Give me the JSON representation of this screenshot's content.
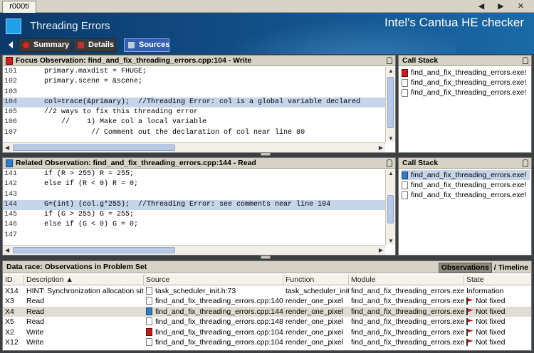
{
  "window": {
    "tab_title": "r000ti",
    "controls": "◀ ▶ ✕"
  },
  "header": {
    "title": "Threading Errors",
    "brand": "Intel's Cantua HE checker"
  },
  "nav": {
    "summary": "Summary",
    "details": "Details",
    "sources": "Sources"
  },
  "focus": {
    "title": "Focus Observation: find_and_fix_threading_errors.cpp:104 - Write",
    "lines": [
      {
        "n": "101",
        "code": "    primary.maxdist = FHUGE;",
        "hl": false
      },
      {
        "n": "102",
        "code": "    primary.scene = &scene;",
        "hl": false
      },
      {
        "n": "103",
        "code": "",
        "hl": false
      },
      {
        "n": "104",
        "code": "    col=trace(&primary);  //Threading Error: col is a global variable declared",
        "hl": true
      },
      {
        "n": "105",
        "code": "    //2 ways to fix this threading error",
        "hl": false
      },
      {
        "n": "106",
        "code": "        //    1) Make col a local variable",
        "hl": false
      },
      {
        "n": "107",
        "code": "               // Comment out the declaration of col near line 80",
        "hl": false
      }
    ]
  },
  "related": {
    "title": "Related Observation: find_and_fix_threading_errors.cpp:144 - Read",
    "lines": [
      {
        "n": "141",
        "code": "    if (R > 255) R = 255;",
        "hl": false
      },
      {
        "n": "142",
        "code": "    else if (R < 0) R = 0;",
        "hl": false
      },
      {
        "n": "143",
        "code": "",
        "hl": false
      },
      {
        "n": "144",
        "code": "    G=(int) (col.g*255);  //Threading Error: see comments near line 104",
        "hl": true
      },
      {
        "n": "145",
        "code": "    if (G > 255) G = 255;",
        "hl": false
      },
      {
        "n": "146",
        "code": "    else if (G < 0) G = 0;",
        "hl": false
      },
      {
        "n": "147",
        "code": "",
        "hl": false
      }
    ]
  },
  "callstack_top": {
    "title": "Call Stack",
    "items": [
      "find_and_fix_threading_errors.exe!",
      "find_and_fix_threading_errors.exe!",
      "find_and_fix_threading_errors.exe!"
    ]
  },
  "callstack_bottom": {
    "title": "Call Stack",
    "items": [
      "find_and_fix_threading_errors.exe!",
      "find_and_fix_threading_errors.exe!",
      "find_and_fix_threading_errors.exe!"
    ]
  },
  "observations": {
    "title": "Data race: Observations in Problem Set",
    "tab_observations": "Observations",
    "tab_sep": "/",
    "tab_timeline": "Timeline",
    "columns": [
      "ID",
      "Description ▲",
      "Source",
      "Function",
      "Module",
      "State"
    ],
    "rows": [
      {
        "id": "X14",
        "desc": "HINT: Synchronization allocation site",
        "source": "task_scheduler_init.h:73",
        "func": "task_scheduler_init",
        "module": "find_and_fix_threading_errors.exe",
        "state": "Information",
        "icon": "doc",
        "flag": false,
        "sel": false
      },
      {
        "id": "X3",
        "desc": "Read",
        "source": "find_and_fix_threading_errors.cpp:140",
        "func": "render_one_pixel",
        "module": "find_and_fix_threading_errors.exe",
        "state": "Not fixed",
        "icon": "doc",
        "flag": true,
        "sel": false
      },
      {
        "id": "X4",
        "desc": "Read",
        "source": "find_and_fix_threading_errors.cpp:144",
        "func": "render_one_pixel",
        "module": "find_and_fix_threading_errors.exe",
        "state": "Not fixed",
        "icon": "blue",
        "flag": true,
        "sel": true
      },
      {
        "id": "X5",
        "desc": "Read",
        "source": "find_and_fix_threading_errors.cpp:148",
        "func": "render_one_pixel",
        "module": "find_and_fix_threading_errors.exe",
        "state": "Not fixed",
        "icon": "doc",
        "flag": true,
        "sel": false
      },
      {
        "id": "X2",
        "desc": "Write",
        "source": "find_and_fix_threading_errors.cpp:104",
        "func": "render_one_pixel",
        "module": "find_and_fix_threading_errors.exe",
        "state": "Not fixed",
        "icon": "red",
        "flag": true,
        "sel": false
      },
      {
        "id": "X12",
        "desc": "Write",
        "source": "find_and_fix_threading_errors.cpp:104",
        "func": "render_one_pixel",
        "module": "find_and_fix_threading_errors.exe",
        "state": "Not fixed",
        "icon": "doc",
        "flag": true,
        "sel": false
      }
    ]
  },
  "colors": {
    "header": "#124d86",
    "highlight": "#c5d5ea",
    "sources_active": "#3560b0"
  }
}
